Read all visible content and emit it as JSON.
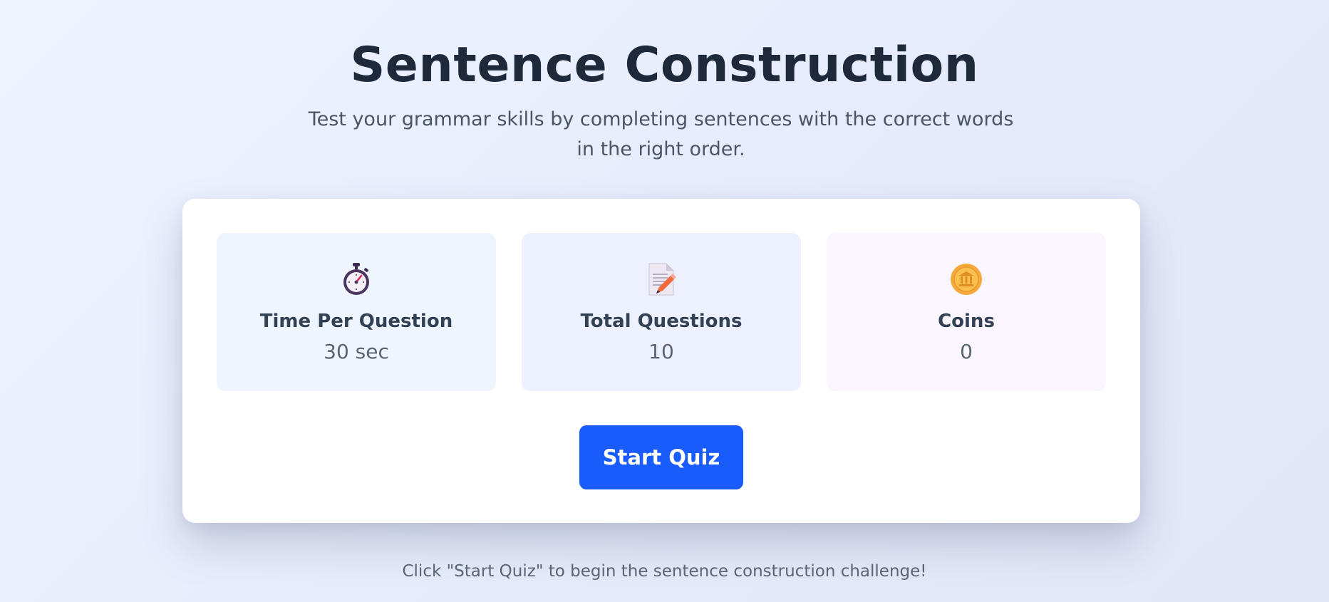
{
  "header": {
    "title": "Sentence Construction",
    "subtitle": "Test your grammar skills by completing sentences with the correct words in the right order."
  },
  "stats": [
    {
      "icon": "stopwatch-icon",
      "label": "Time Per Question",
      "value": "30 sec"
    },
    {
      "icon": "memo-icon",
      "label": "Total Questions",
      "value": "10"
    },
    {
      "icon": "coin-icon",
      "label": "Coins",
      "value": "0"
    }
  ],
  "actions": {
    "start_label": "Start Quiz"
  },
  "footer": {
    "hint": "Click \"Start Quiz\" to begin the sentence construction challenge!"
  },
  "colors": {
    "primary": "#1a5cfb",
    "title": "#1e293b",
    "muted": "#5b6472"
  }
}
